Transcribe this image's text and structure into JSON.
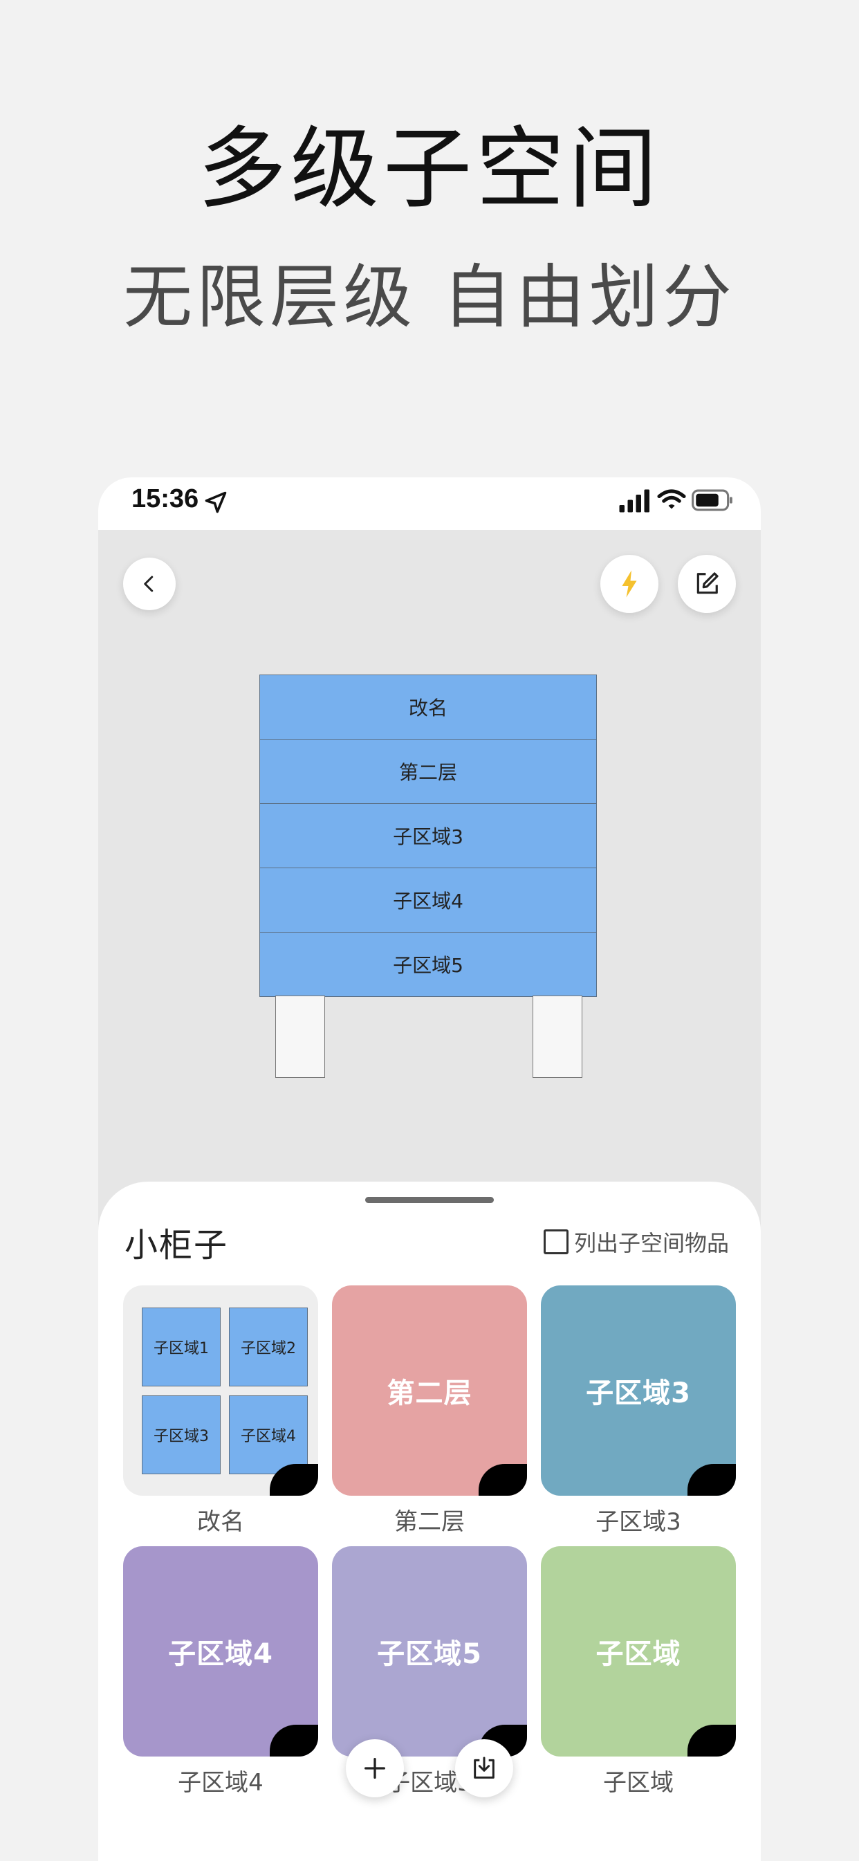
{
  "promo": {
    "title": "多级子空间",
    "subtitle": "无限层级  自由划分"
  },
  "statusbar": {
    "time": "15:36",
    "icons": [
      "location-arrow-icon",
      "signal-icon",
      "wifi-icon",
      "battery-icon"
    ]
  },
  "toolbar": {
    "back_icon": "chevron-left-icon",
    "quick_icon": "lightning-icon",
    "edit_icon": "edit-icon",
    "accent_yellow": "#f5c12e"
  },
  "cabinet": {
    "drawers": [
      "改名",
      "第二层",
      "子区域3",
      "子区域4",
      "子区域5"
    ],
    "color": "#77b0ee"
  },
  "sheet": {
    "title": "小柜子",
    "checkbox_label": "列出子空间物品",
    "checkbox_checked": false,
    "cards": [
      {
        "label": "改名",
        "text": "",
        "color": "#eeeeee",
        "mini": [
          "子区域1",
          "子区域2",
          "子区域3",
          "子区域4"
        ]
      },
      {
        "label": "第二层",
        "text": "第二层",
        "color": "#e5a3a3"
      },
      {
        "label": "子区域3",
        "text": "子区域3",
        "color": "#71a9c1"
      },
      {
        "label": "子区域4",
        "text": "子区域4",
        "color": "#a696cb"
      },
      {
        "label": "子区域5",
        "text": "子区域5",
        "color": "#aba6d1"
      },
      {
        "label": "子区域",
        "text": "子区域",
        "color": "#b2d39c"
      }
    ],
    "add_icon": "plus-icon",
    "export_icon": "download-tray-icon"
  }
}
